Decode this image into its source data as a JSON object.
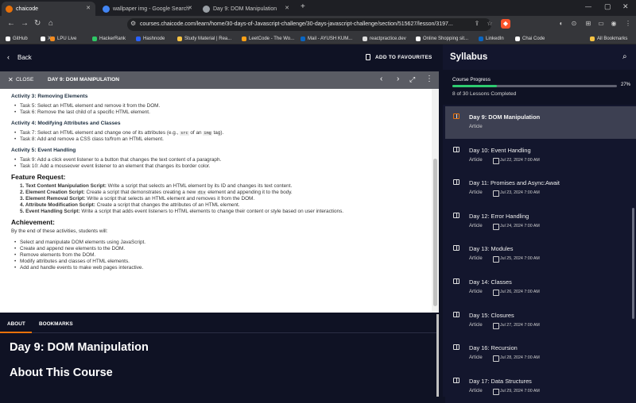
{
  "browser": {
    "tabs": [
      {
        "label": "chaicode",
        "active": true,
        "color": "#e8710a"
      },
      {
        "label": "wallpaper img - Google Search",
        "active": false,
        "color": "#4285f4"
      },
      {
        "label": "Day 9: DOM Manipulation",
        "active": false,
        "color": "#9aa0a6"
      }
    ],
    "url": "courses.chaicode.com/learn/home/30-days-of-Javascript-challenge/30-days-javascript-challenge/section/515627/lesson/3197...",
    "bookmarks": [
      {
        "label": "GitHub",
        "color": "#ffffff"
      },
      {
        "label": "X",
        "color": "#ffffff"
      },
      {
        "label": "LPU Live",
        "color": "#f28b20"
      },
      {
        "label": "HackerRank",
        "color": "#2ec866"
      },
      {
        "label": "Hashnode",
        "color": "#2962ff"
      },
      {
        "label": "Study Material | Rea...",
        "color": "#f6c343"
      },
      {
        "label": "LeetCode - The Wo...",
        "color": "#ffa116"
      },
      {
        "label": "Mail - AYUSH KUM...",
        "color": "#0a66c2"
      },
      {
        "label": "reactpractice.dev",
        "color": "#dddddd"
      },
      {
        "label": "Online Shopping sit...",
        "color": "#ffffff"
      },
      {
        "label": "LinkedIn",
        "color": "#0a66c2"
      },
      {
        "label": "Chai Code",
        "color": "#ffffff"
      }
    ],
    "all_bookmarks": "All Bookmarks"
  },
  "topbar": {
    "back": "Back",
    "favourites": "ADD TO FAVOURITES"
  },
  "lessonbar": {
    "close": "CLOSE",
    "title": "DAY 9: DOM MANIPULATION"
  },
  "content": {
    "act3": "Activity 3: Removing Elements",
    "task5": "Task 5: Select an HTML element and remove it from the DOM.",
    "task6": "Task 6: Remove the last child of a specific HTML element.",
    "act4": "Activity 4: Modifying Attributes and Classes",
    "task7a": "Task 7: Select an HTML element and change one of its attributes (e.g.,",
    "task7code1": "src",
    "task7b": "of an",
    "task7code2": "img",
    "task7c": "tag).",
    "task8": "Task 8: Add and remove a CSS class to/from an HTML element.",
    "act5": "Activity 5: Event Handling",
    "task9": "Task 9: Add a click event listener to a button that changes the text content of a paragraph.",
    "task10": "Task 10: Add a mouseover event listener to an element that changes its border color.",
    "feature_heading": "Feature Request:",
    "f1b": "1. Text Content Manipulation Script:",
    "f1": "Write a script that selects an HTML element by its ID and changes its text content.",
    "f2b": "2. Element Creation Script:",
    "f2a": "Create a script that demonstrates creating a new",
    "f2code": "div",
    "f2c": "element and appending it to the body.",
    "f3b": "3. Element Removal Script:",
    "f3": "Write a script that selects an HTML element and removes it from the DOM.",
    "f4b": "4. Attribute Modification Script:",
    "f4": "Create a script that changes the attributes of an HTML element.",
    "f5b": "5. Event Handling Script:",
    "f5": "Write a script that adds event listeners to HTML elements to change their content or style based on user interactions.",
    "ach_heading": "Achievement:",
    "ach_intro": "By the end of these activities, students will:",
    "a1": "Select and manipulate DOM elements using JavaScript.",
    "a2": "Create and append new elements to the DOM.",
    "a3": "Remove elements from the DOM.",
    "a4": "Modify attributes and classes of HTML elements.",
    "a5": "Add and handle events to make web pages interactive."
  },
  "about_tabs": {
    "about": "ABOUT",
    "bookmarks": "BOOKMARKS"
  },
  "about": {
    "title": "Day 9: DOM Manipulation",
    "subtitle": "About This Course"
  },
  "sidebar": {
    "title": "Syllabus",
    "progress_label": "Course Progress",
    "progress_percent": "27%",
    "progress_value": 0.27,
    "lessons_completed": "8 of 30 Lessons Completed",
    "lessons": [
      {
        "title": "Day 9: DOM Manipulation",
        "type": "Article",
        "date": "",
        "active": true
      },
      {
        "title": "Day 10: Event Handling",
        "type": "Article",
        "date": "Jul 22, 2024 7:00 AM"
      },
      {
        "title": "Day 11: Promises and Async:Await",
        "type": "Article",
        "date": "Jul 23, 2024 7:00 AM"
      },
      {
        "title": "Day 12: Error Handling",
        "type": "Article",
        "date": "Jul 24, 2024 7:00 AM"
      },
      {
        "title": "Day 13: Modules",
        "type": "Article",
        "date": "Jul 25, 2024 7:00 AM"
      },
      {
        "title": "Day 14: Classes",
        "type": "Article",
        "date": "Jul 26, 2024 7:00 AM"
      },
      {
        "title": "Day 15: Closures",
        "type": "Article",
        "date": "Jul 27, 2024 7:00 AM"
      },
      {
        "title": "Day 16: Recursion",
        "type": "Article",
        "date": "Jul 28, 2024 7:00 AM"
      },
      {
        "title": "Day 17: Data Structures",
        "type": "Article",
        "date": "Jul 29, 2024 7:00 AM"
      }
    ]
  },
  "colors": {
    "accent": "#e8710a",
    "progress": "#2ecc71",
    "bg": "#0f1224"
  }
}
